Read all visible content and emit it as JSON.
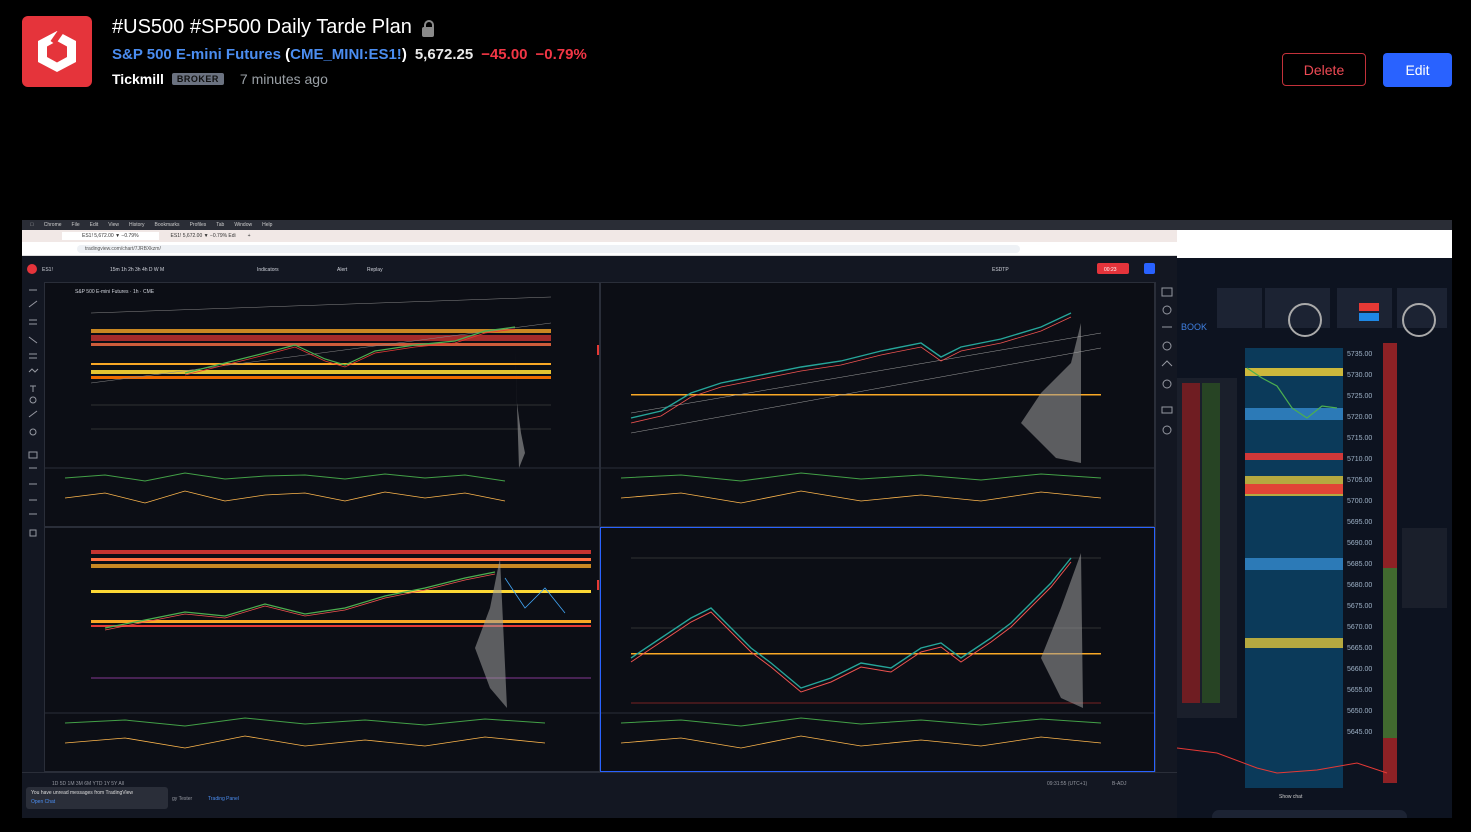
{
  "post": {
    "title": "#US500 #SP500 Daily Tarde Plan",
    "symbol_name": "S&P 500 E-mini Futures",
    "ticker": "CME_MINI:ES1!",
    "price": "5,672.25",
    "change": "−45.00",
    "change_pct": "−0.79%",
    "author": "Tickmill",
    "author_badge": "BROKER",
    "time_ago": "7 minutes ago"
  },
  "actions": {
    "delete_label": "Delete",
    "edit_label": "Edit"
  },
  "screenshot": {
    "browser_url": "tradingview.com/chart/7JRBXkzm/",
    "chart_symbol": "ES1!",
    "panel1_title": "S&P 500 E-mini Futures · 1h · CME",
    "notification": "You have unread messages from TradingView",
    "notification_link": "Open Chat",
    "bottom_time": "09:31:55 (UTC+1)",
    "tab_label": "Trading Panel",
    "strategy_tab": "gy Tester",
    "orderbook_label": "BOOK",
    "chat_label": "Show chat",
    "ladder_prices": [
      "5735.00",
      "5730.00",
      "5725.00",
      "5720.00",
      "5715.00",
      "5710.00",
      "5705.00",
      "5700.00",
      "5695.00",
      "5690.00",
      "5685.00",
      "5680.00",
      "5675.00",
      "5670.00",
      "5665.00",
      "5660.00",
      "5655.00",
      "5650.00",
      "5645.00"
    ]
  },
  "colors": {
    "brand_red": "#e5343b",
    "link_blue": "#4b8df0",
    "negative": "#f23645",
    "edit_blue": "#2962ff"
  },
  "icons": {
    "logo": "tickmill-logo",
    "lock": "lock-icon"
  }
}
